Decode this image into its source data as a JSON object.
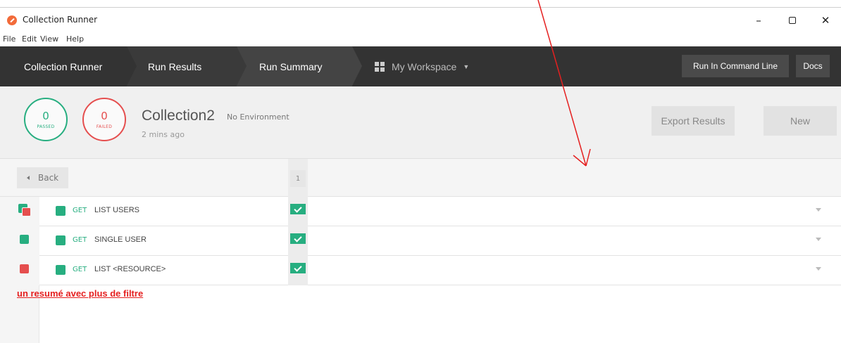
{
  "window": {
    "title": "Collection Runner",
    "minimize": "–",
    "close": "✕"
  },
  "menu": [
    "File",
    "Edit",
    "View",
    "Help"
  ],
  "nav": {
    "crumbs": [
      "Collection Runner",
      "Run Results",
      "Run Summary"
    ],
    "workspace": "My Workspace",
    "run_cli": "Run In Command Line",
    "docs": "Docs"
  },
  "summary": {
    "passed_count": "0",
    "passed_label": "PASSED",
    "failed_count": "0",
    "failed_label": "FAILED",
    "collection_name": "Collection2",
    "environment": "No Environment",
    "time_ago": "2 mins ago",
    "export_label": "Export Results",
    "new_label": "New"
  },
  "filter": {
    "back_label": "Back",
    "iteration": "1"
  },
  "requests": [
    {
      "method": "GET",
      "name": "LIST USERS"
    },
    {
      "method": "GET",
      "name": "SINGLE USER"
    },
    {
      "method": "GET",
      "name": "LIST <RESOURCE>"
    }
  ],
  "annotation": {
    "note": "un resumé avec plus de filtre",
    "arrow_color": "#e52020"
  },
  "colors": {
    "pass": "#27ae80",
    "fail": "#e54e4e",
    "nav_bg": "#333333"
  }
}
